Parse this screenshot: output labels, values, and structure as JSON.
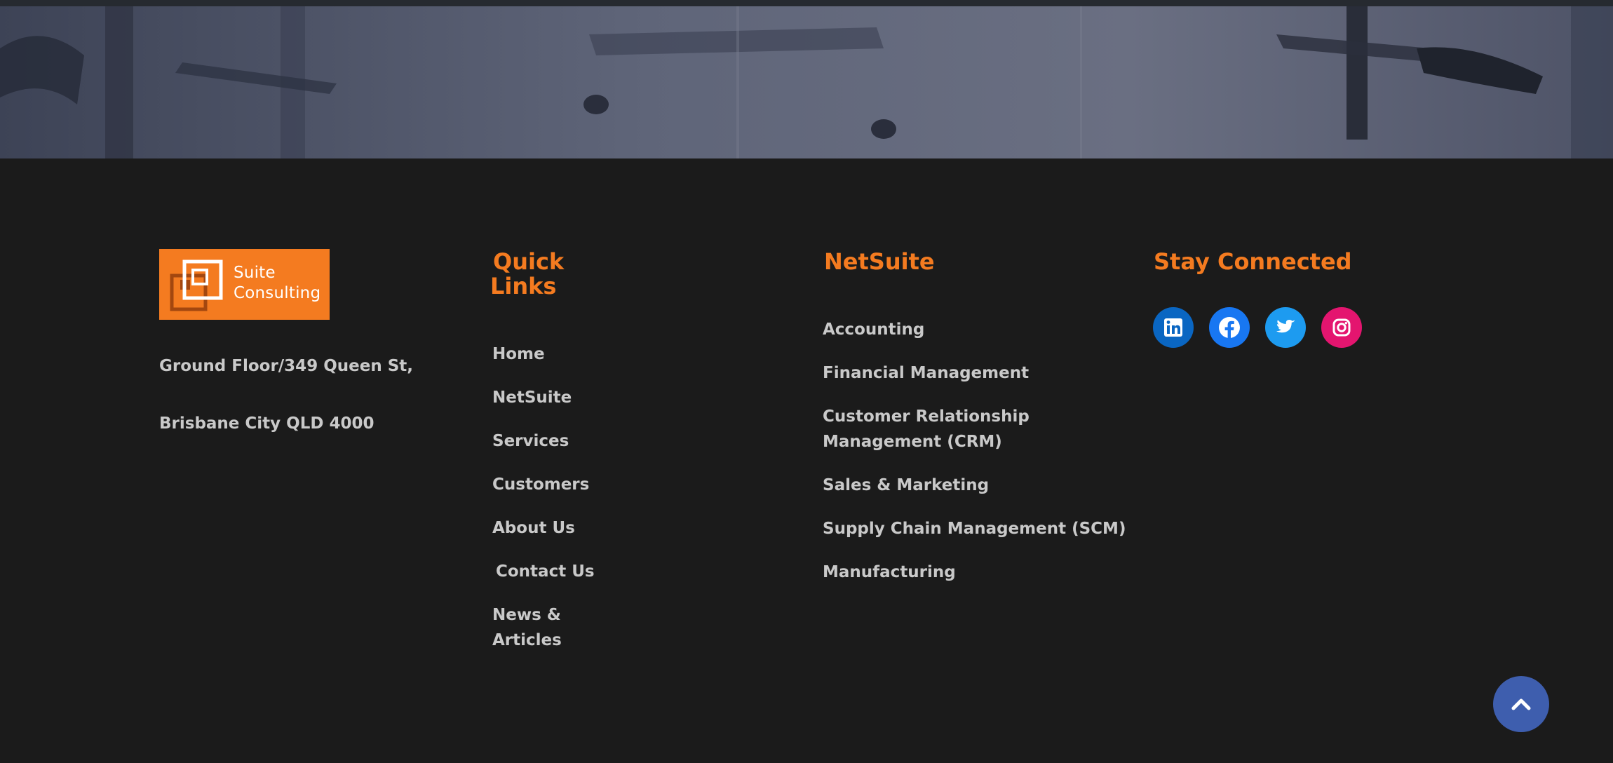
{
  "brand": {
    "logo_line1": "Suite",
    "logo_line2": "Consulting",
    "accent_color": "#f47b20"
  },
  "address": {
    "line1": "Ground Floor/349 Queen St,",
    "line2": "Brisbane City QLD 4000"
  },
  "quick_links": {
    "heading_line1": "Quick",
    "heading_line2": "Links",
    "items": [
      {
        "label": "Home"
      },
      {
        "label": "NetSuite"
      },
      {
        "label": "Services"
      },
      {
        "label": "Customers"
      },
      {
        "label": "About Us"
      },
      {
        "label": "Contact Us"
      },
      {
        "label_line1": "News &",
        "label_line2": "Articles"
      }
    ]
  },
  "netsuite": {
    "heading": "NetSuite",
    "items": [
      {
        "label": "Accounting"
      },
      {
        "label": "Financial Management"
      },
      {
        "label_line1": "Customer Relationship",
        "label_line2": "Management (CRM)"
      },
      {
        "label": "Sales & Marketing"
      },
      {
        "label": "Supply Chain Management (SCM)"
      },
      {
        "label": "Manufacturing"
      }
    ]
  },
  "stay_connected": {
    "heading": "Stay Connected",
    "social": [
      {
        "icon": "linkedin-icon",
        "color": "#0a66c2"
      },
      {
        "icon": "facebook-icon",
        "color": "#1877f2"
      },
      {
        "icon": "twitter-icon",
        "color": "#1d9bf0"
      },
      {
        "icon": "instagram-icon",
        "color": "#e4156f"
      }
    ]
  },
  "back_to_top": {
    "icon": "chevron-up-icon",
    "color": "#3e5eae"
  }
}
